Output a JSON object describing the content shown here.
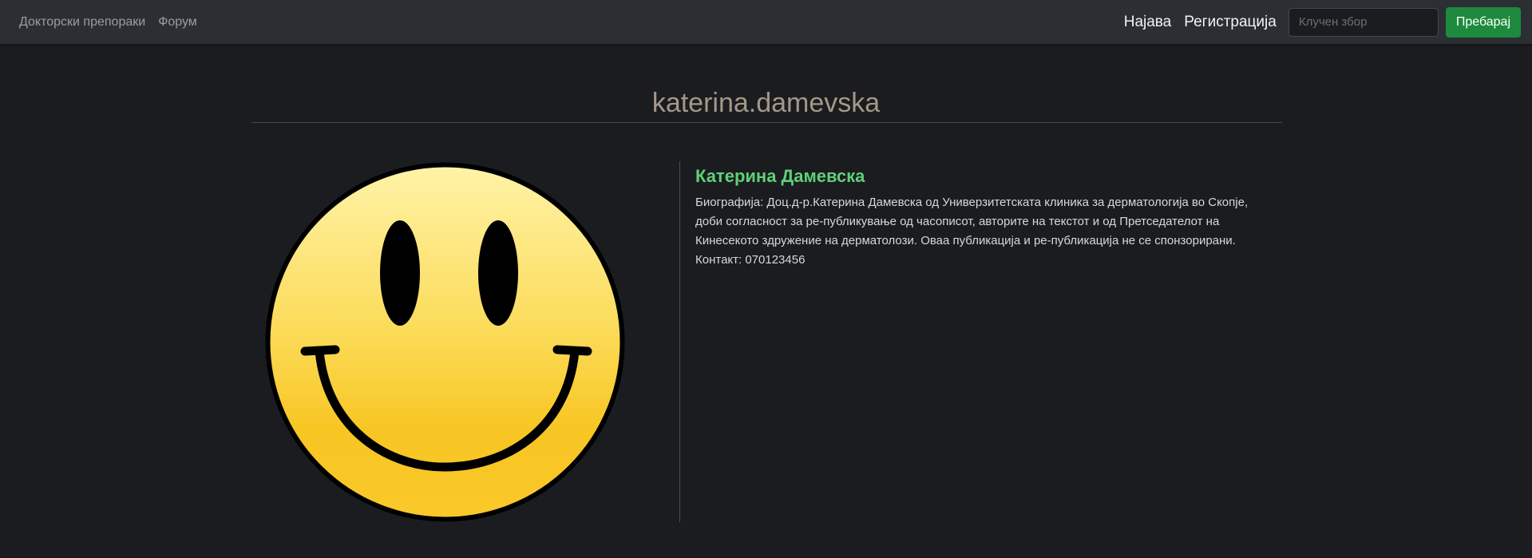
{
  "nav": {
    "doctor_recommendations": "Докторски препораки",
    "forum": "Форум",
    "login": "Најава",
    "register": "Регистрација",
    "search_placeholder": "Клучен збор",
    "search_button": "Пребарај"
  },
  "profile": {
    "username": "katerina.damevska",
    "full_name": "Катерина Дамевска",
    "bio": "Биографија: Доц.д-р.Катерина Дамевска од Универзитетската клиника за дерматологија во Скопје, доби согласност за ре-публикување од часописот, авторите на текстот и од Претседателот на Кинесекото здружение на дерматолози. Оваа публикација и ре-публикација не се спонзорирани.",
    "contact": "Контакт: 070123456"
  },
  "colors": {
    "navbar_bg": "#2b2e33",
    "page_bg": "#1b1c1f",
    "accent_green": "#5fd07a",
    "button_green": "#1e8a3e",
    "title_color": "#a39888"
  },
  "icons": {
    "avatar": "smiley-face-icon"
  }
}
